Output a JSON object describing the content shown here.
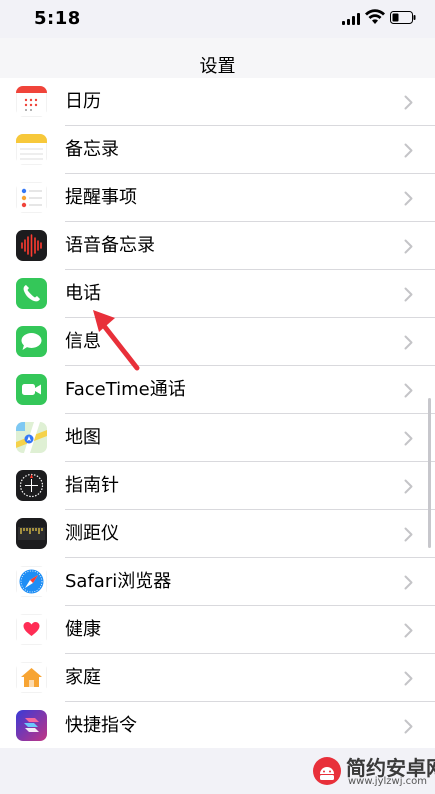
{
  "status_bar": {
    "time": "5:18"
  },
  "nav": {
    "title": "设置"
  },
  "items": [
    {
      "label": "日历",
      "icon": "calendar-icon"
    },
    {
      "label": "备忘录",
      "icon": "notes-icon"
    },
    {
      "label": "提醒事项",
      "icon": "reminders-icon"
    },
    {
      "label": "语音备忘录",
      "icon": "voice-memos-icon"
    },
    {
      "label": "电话",
      "icon": "phone-icon"
    },
    {
      "label": "信息",
      "icon": "messages-icon"
    },
    {
      "label": "FaceTime通话",
      "icon": "facetime-icon"
    },
    {
      "label": "地图",
      "icon": "maps-icon"
    },
    {
      "label": "指南针",
      "icon": "compass-icon"
    },
    {
      "label": "测距仪",
      "icon": "measure-icon"
    },
    {
      "label": "Safari浏览器",
      "icon": "safari-icon"
    },
    {
      "label": "健康",
      "icon": "health-icon"
    },
    {
      "label": "家庭",
      "icon": "home-icon"
    },
    {
      "label": "快捷指令",
      "icon": "shortcuts-icon"
    }
  ],
  "watermark": {
    "name": "简约安卓网",
    "url": "www.jylzwj.com"
  },
  "colors": {
    "accent_arrow": "#e8303a",
    "phone_green": "#34c759"
  }
}
